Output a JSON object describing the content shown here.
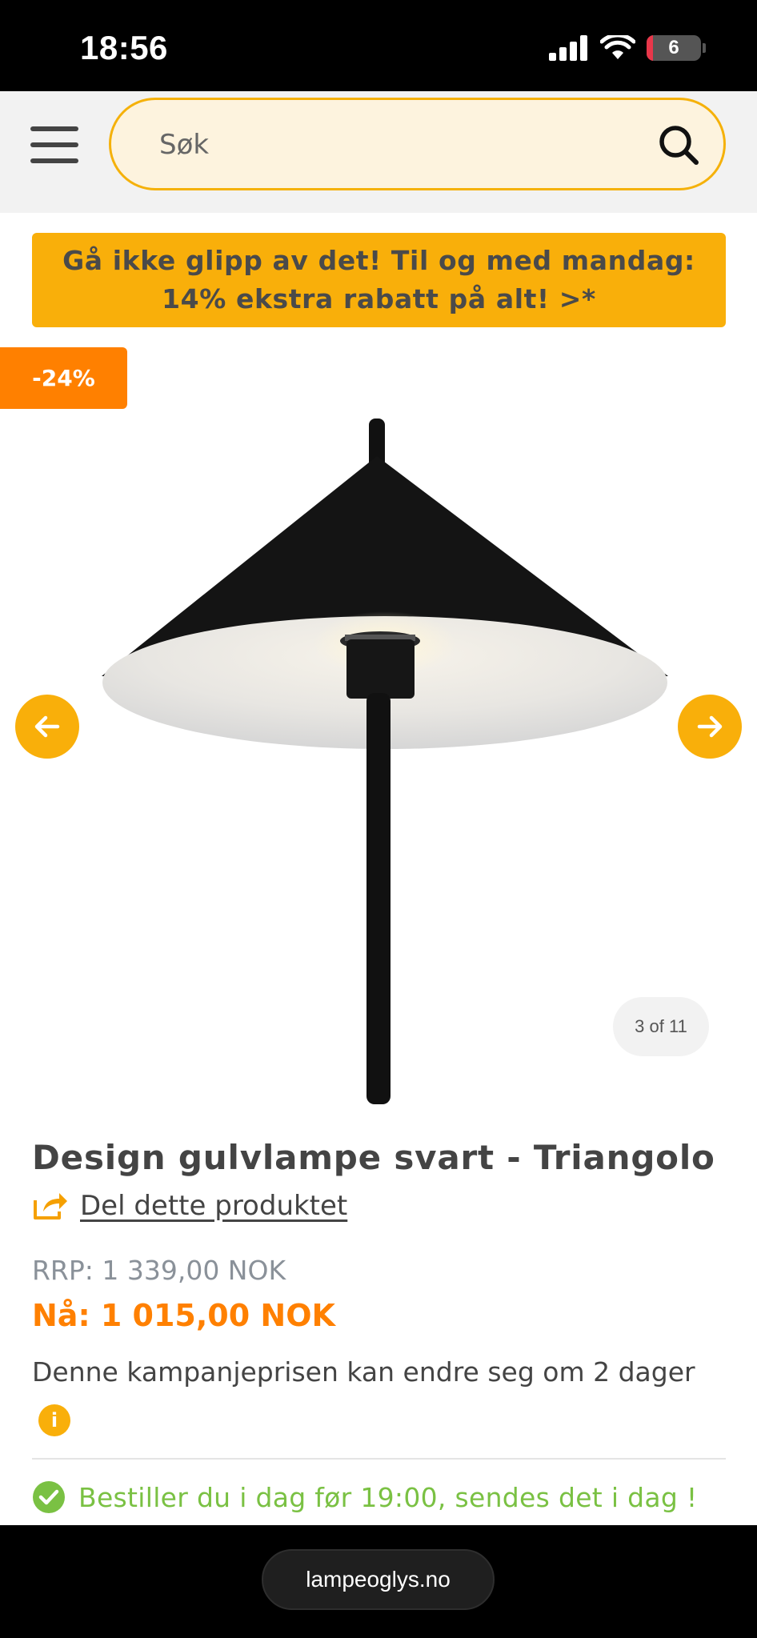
{
  "status_bar": {
    "time": "18:56",
    "battery_level": "6"
  },
  "header": {
    "search_placeholder": "Søk"
  },
  "promo": {
    "line1": "Gå ikke glipp av det! Til og med mandag:",
    "line2": "14% ekstra rabatt på alt! >*"
  },
  "gallery": {
    "badge": "-24%",
    "counter": "3 of 11",
    "current_image": 3,
    "total_images": 11
  },
  "product": {
    "title": "Design gulvlampe svart - Triangolo",
    "share_label": "Del dette produktet",
    "rrp": "RRP:  1 339,00 NOK",
    "now_price": "Nå: 1 015,00 NOK",
    "campaign_note": "Denne kampanjeprisen kan endre seg om 2 dager",
    "shipping_note": "Bestiller du i dag før 19:00, sendes det i dag !"
  },
  "browser": {
    "url": "lampeoglys.no"
  },
  "colors": {
    "accent": "#f9af0a",
    "sale": "#ff8000",
    "success": "#7ac143",
    "text": "#444444"
  },
  "icons": [
    "menu-icon",
    "search-icon",
    "arrow-left-icon",
    "arrow-right-icon",
    "share-icon",
    "info-icon",
    "check-circle-icon",
    "signal-icon",
    "wifi-icon",
    "battery-icon"
  ]
}
